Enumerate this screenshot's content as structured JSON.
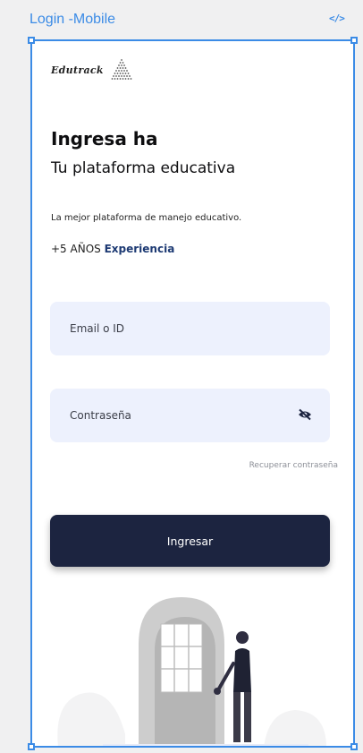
{
  "canvas": {
    "frame_title": "Login -Mobile",
    "code_icon": "</>"
  },
  "app": {
    "logo_text": "Edutrack",
    "heading": "Ingresa ha",
    "subheading": "Tu plataforma educativa",
    "description": "La mejor plataforma de manejo educativo.",
    "years_prefix": "+5 AÑOS",
    "years_highlight": "Experiencia"
  },
  "form": {
    "email_placeholder": "Email o ID",
    "password_placeholder": "Contraseña",
    "recover_link": "Recuperar contraseña",
    "submit_label": "Ingresar"
  },
  "colors": {
    "selection": "#3b8be6",
    "primary_button": "#1c2440",
    "field_background": "#edf1fd",
    "accent_text": "#1d3a73"
  },
  "icons": [
    "code-icon",
    "logo-mark-icon",
    "eye-off-icon"
  ]
}
